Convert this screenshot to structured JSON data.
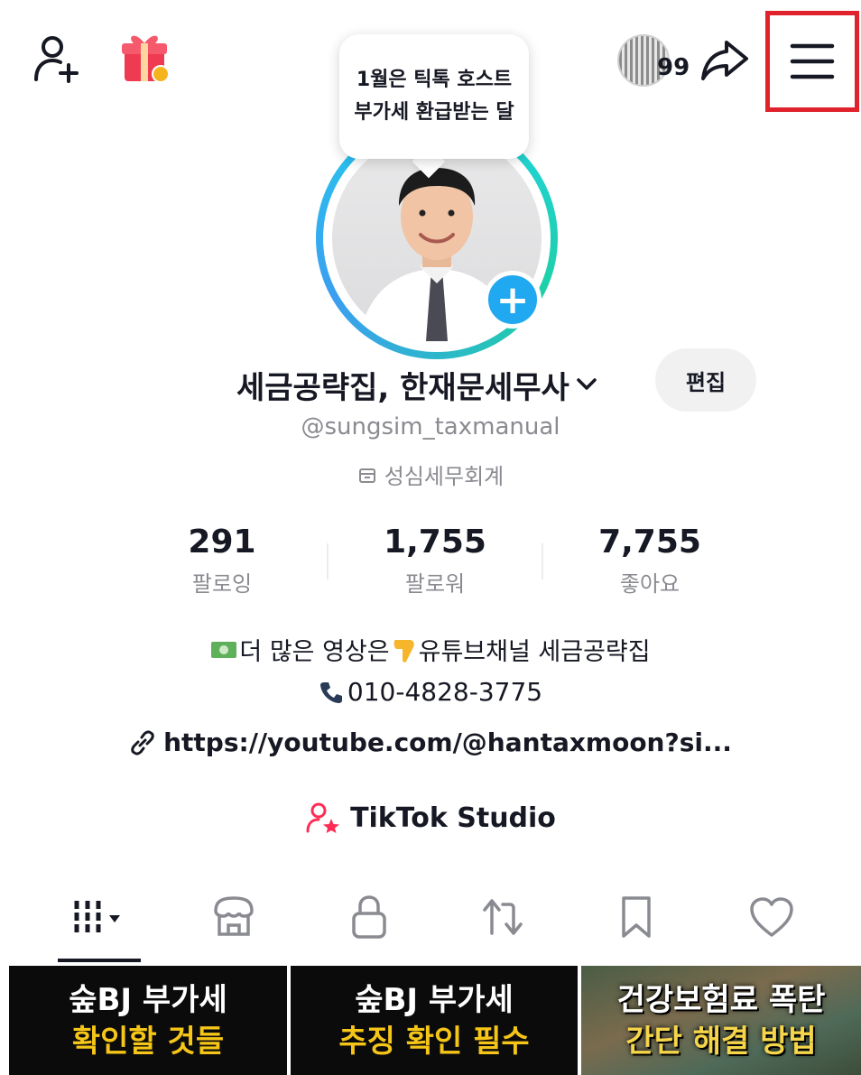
{
  "top_bar": {
    "add_friend_icon": "person-plus-icon",
    "gift_icon": "gift-icon",
    "badge_count": "99",
    "share_icon": "share-arrow-icon",
    "menu_icon": "hamburger-menu-icon",
    "highlight_color": "#e0222c"
  },
  "story_bubble": {
    "text": "1월은 틱톡 호스트 부가세 환급받는 달"
  },
  "profile": {
    "name": "세금공략집, 한재문세무사",
    "edit_label": "편집",
    "handle": "@sungsim_taxmanual",
    "org": "성심세무회계",
    "ring_color": "#20d5ec",
    "plus_color": "#20a8f0"
  },
  "stats": [
    {
      "value": "291",
      "label": "팔로잉"
    },
    {
      "value": "1,755",
      "label": "팔로워"
    },
    {
      "value": "7,755",
      "label": "좋아요"
    }
  ],
  "bio": {
    "line1": "더 많은 영상은",
    "line1_suffix": "유튜브채널 세금공략집",
    "phone": "010-4828-3775",
    "link": "https://youtube.com/@hantaxmoon?si..."
  },
  "studio": {
    "label": "TikTok Studio"
  },
  "tabs": [
    {
      "name": "videos-grid-icon"
    },
    {
      "name": "shop-icon"
    },
    {
      "name": "lock-icon"
    },
    {
      "name": "repost-icon"
    },
    {
      "name": "bookmark-icon"
    },
    {
      "name": "heart-icon"
    }
  ],
  "thumbnails": [
    {
      "line1": "숲BJ 부가세",
      "line2": "확인할 것들"
    },
    {
      "line1": "숲BJ 부가세",
      "line2": "추징 확인 필수"
    },
    {
      "line1": "건강보험료 폭탄",
      "line2": "간단 해결 방법"
    }
  ]
}
